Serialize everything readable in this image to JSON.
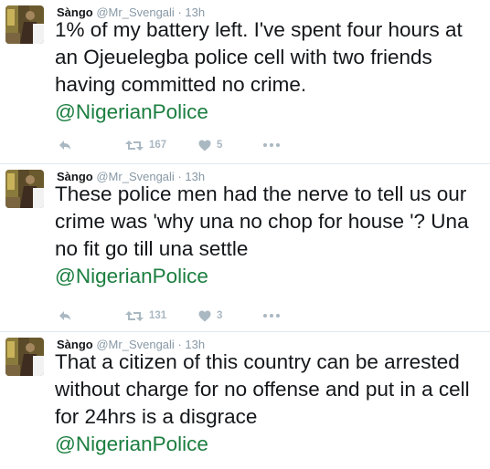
{
  "tweets": [
    {
      "display_name": "Sàngo",
      "handle": "@Mr_Svengali",
      "separator": "·",
      "time": "13h",
      "text": "1% of my battery left.  I've spent four hours at an Ojeuelegba police cell with two friends having committed no crime.",
      "mention": "@NigerianPolice",
      "retweets": "167",
      "likes": "5"
    },
    {
      "display_name": "Sàngo",
      "handle": "@Mr_Svengali",
      "separator": "·",
      "time": "13h",
      "text": "These police men had the nerve to tell us our crime was 'why una no chop for house '? Una no fit go till una settle",
      "mention": "@NigerianPolice",
      "retweets": "131",
      "likes": "3"
    },
    {
      "display_name": "Sàngo",
      "handle": "@Mr_Svengali",
      "separator": "·",
      "time": "13h",
      "text": "That a citizen of this country can be arrested without charge for no offense and put in a cell for 24hrs is a disgrace",
      "mention": "@NigerianPolice"
    }
  ],
  "icons": {
    "reply": "reply-icon",
    "retweet": "retweet-icon",
    "like": "heart-icon",
    "more": "more-icon"
  },
  "colors": {
    "mention": "#1b7e3f",
    "meta": "#8899a6",
    "action": "#aab8c2"
  }
}
